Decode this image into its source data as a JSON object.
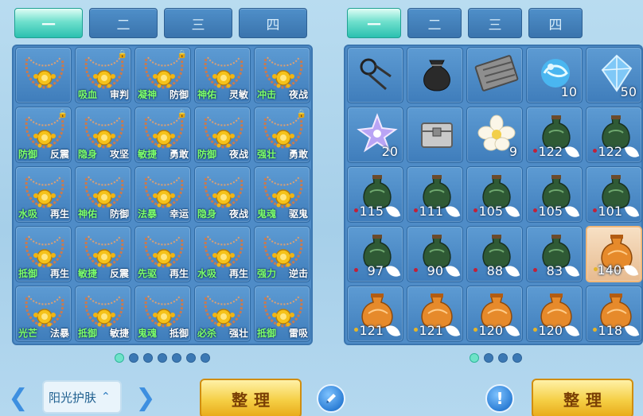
{
  "left_tabs": [
    "一",
    "二",
    "三",
    "四"
  ],
  "right_tabs": [
    "一",
    "二",
    "三",
    "四"
  ],
  "left_grid": [
    {
      "a": "",
      "b": "",
      "locked": false
    },
    {
      "a": "吸血",
      "b": "审判",
      "locked": true
    },
    {
      "a": "凝神",
      "b": "防御",
      "locked": true
    },
    {
      "a": "神佑",
      "b": "灵敏",
      "locked": false
    },
    {
      "a": "冲击",
      "b": "夜战",
      "locked": false
    },
    {
      "a": "防御",
      "b": "反震",
      "locked": true
    },
    {
      "a": "隐身",
      "b": "攻坚",
      "locked": false
    },
    {
      "a": "敏捷",
      "b": "勇敢",
      "locked": true
    },
    {
      "a": "防御",
      "b": "夜战",
      "locked": false
    },
    {
      "a": "强壮",
      "b": "勇敢",
      "locked": true
    },
    {
      "a": "水吸",
      "b": "再生",
      "locked": false
    },
    {
      "a": "神佑",
      "b": "防御",
      "locked": false
    },
    {
      "a": "法暴",
      "b": "幸运",
      "locked": false
    },
    {
      "a": "隐身",
      "b": "夜战",
      "locked": false
    },
    {
      "a": "鬼魂",
      "b": "驱鬼",
      "locked": false
    },
    {
      "a": "抵御",
      "b": "再生",
      "locked": false
    },
    {
      "a": "敏捷",
      "b": "反震",
      "locked": false
    },
    {
      "a": "先驱",
      "b": "再生",
      "locked": false
    },
    {
      "a": "水吸",
      "b": "再生",
      "locked": false
    },
    {
      "a": "强力",
      "b": "逆击",
      "locked": false
    },
    {
      "a": "光芒",
      "b": "法暴",
      "locked": false
    },
    {
      "a": "抵御",
      "b": "敏捷",
      "locked": false
    },
    {
      "a": "鬼魂",
      "b": "抵御",
      "locked": false
    },
    {
      "a": "必杀",
      "b": "强壮",
      "locked": false
    },
    {
      "a": "抵御",
      "b": "雷吸",
      "locked": false
    }
  ],
  "right_grid": [
    {
      "icon": "spectacles-icon",
      "qty": "",
      "leaf": false,
      "dot": ""
    },
    {
      "icon": "pouch-icon",
      "qty": "",
      "leaf": false,
      "dot": ""
    },
    {
      "icon": "abacus-icon",
      "qty": "",
      "leaf": false,
      "dot": ""
    },
    {
      "icon": "water-orb-icon",
      "qty": "10",
      "leaf": false,
      "dot": ""
    },
    {
      "icon": "crystal-icon",
      "qty": "50",
      "leaf": false,
      "dot": ""
    },
    {
      "icon": "star-crystal-icon",
      "qty": "20",
      "leaf": false,
      "dot": ""
    },
    {
      "icon": "treasure-chest-icon",
      "qty": "",
      "leaf": false,
      "dot": ""
    },
    {
      "icon": "white-flower-icon",
      "qty": "9",
      "leaf": false,
      "dot": ""
    },
    {
      "icon": "green-jar-icon",
      "qty": "122",
      "leaf": true,
      "dot": "#c0213a"
    },
    {
      "icon": "green-jar-icon",
      "qty": "122",
      "leaf": true,
      "dot": "#c0213a"
    },
    {
      "icon": "green-jar-icon",
      "qty": "115",
      "leaf": true,
      "dot": "#c0213a"
    },
    {
      "icon": "green-jar-icon",
      "qty": "111",
      "leaf": true,
      "dot": "#c0213a"
    },
    {
      "icon": "green-jar-icon",
      "qty": "105",
      "leaf": true,
      "dot": "#c0213a"
    },
    {
      "icon": "green-jar-icon",
      "qty": "105",
      "leaf": true,
      "dot": "#c0213a"
    },
    {
      "icon": "green-jar-icon",
      "qty": "101",
      "leaf": true,
      "dot": "#c0213a"
    },
    {
      "icon": "green-jar-icon",
      "qty": "97",
      "leaf": true,
      "dot": "#c0213a"
    },
    {
      "icon": "green-jar-icon",
      "qty": "90",
      "leaf": true,
      "dot": "#c0213a"
    },
    {
      "icon": "green-jar-icon",
      "qty": "88",
      "leaf": true,
      "dot": "#c0213a"
    },
    {
      "icon": "green-jar-icon",
      "qty": "83",
      "leaf": true,
      "dot": "#c0213a"
    },
    {
      "icon": "orange-jar-icon",
      "qty": "140",
      "leaf": true,
      "dot": "#e5b52a"
    },
    {
      "icon": "orange-jar-icon",
      "qty": "121",
      "leaf": true,
      "dot": "#e5b52a"
    },
    {
      "icon": "orange-jar-icon",
      "qty": "121",
      "leaf": true,
      "dot": "#e5b52a"
    },
    {
      "icon": "orange-jar-icon",
      "qty": "120",
      "leaf": true,
      "dot": "#e5b52a"
    },
    {
      "icon": "orange-jar-icon",
      "qty": "120",
      "leaf": true,
      "dot": "#e5b52a"
    },
    {
      "icon": "orange-jar-icon",
      "qty": "118",
      "leaf": true,
      "dot": "#e5b52a"
    }
  ],
  "selected_right_index": 19,
  "left_pages": 7,
  "left_current_page": 0,
  "right_pages": 4,
  "right_current_page": 0,
  "bottom": {
    "skin_label": "阳光护肤",
    "sort_label_left": "整理",
    "sort_label_right": "整理",
    "edit_icon": "pencil-icon",
    "info_icon": "exclamation-icon"
  },
  "colors": {
    "tab_active": "#2bc0b0",
    "tab_inactive": "#3a74ad",
    "cell_bg": "#4f8cc7",
    "sort_button": "#f5cf45",
    "attr_highlight": "#7dff6a"
  }
}
